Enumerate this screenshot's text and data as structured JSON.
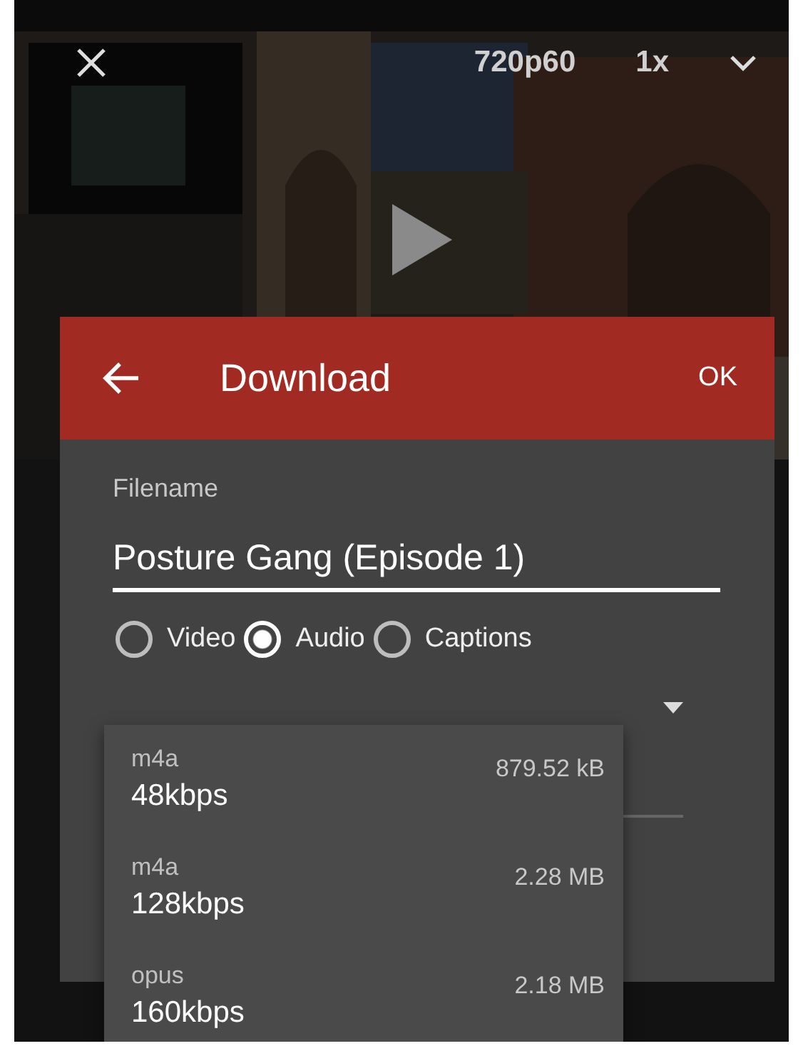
{
  "player": {
    "quality": "720p60",
    "speed": "1x"
  },
  "dialog": {
    "title": "Download",
    "ok": "OK",
    "filename": {
      "label": "Filename",
      "value": "Posture Gang (Episode 1)"
    },
    "types": [
      {
        "label": "Video",
        "selected": false
      },
      {
        "label": "Audio",
        "selected": true
      },
      {
        "label": "Captions",
        "selected": false
      }
    ],
    "formats": [
      {
        "format": "m4a",
        "bitrate": "48kbps",
        "size": "879.52 kB"
      },
      {
        "format": "m4a",
        "bitrate": "128kbps",
        "size": "2.28 MB"
      },
      {
        "format": "opus",
        "bitrate": "160kbps",
        "size": "2.18 MB"
      }
    ]
  }
}
